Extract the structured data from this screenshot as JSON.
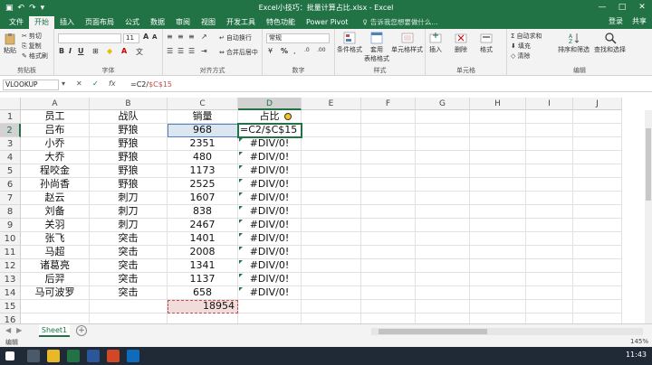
{
  "titlebar": {
    "title": "Excel小技巧：批量计算占比.xlsx - Excel",
    "qat": [
      "save",
      "undo",
      "redo",
      "customize"
    ],
    "window_buttons": [
      "—",
      "□",
      "✕"
    ]
  },
  "tabs": {
    "items": [
      "文件",
      "开始",
      "插入",
      "页面布局",
      "公式",
      "数据",
      "审阅",
      "视图",
      "开发工具",
      "特色功能",
      "Power Pivot"
    ],
    "active": "开始",
    "tell_me": "告诉我您想要做什么...",
    "right": [
      "登录",
      "共享"
    ]
  },
  "ribbon": {
    "clipboard": {
      "paste": "粘贴",
      "cut": "剪切",
      "copy": "复制",
      "format_painter": "格式刷",
      "group_label": "剪贴板"
    },
    "font": {
      "font_size": "11",
      "group_label": "字体"
    },
    "alignment": {
      "wrap": "自动换行",
      "merge": "合并后居中",
      "group_label": "对齐方式"
    },
    "number": {
      "format": "常规",
      "percent": "%",
      "group_label": "数字"
    },
    "styles": {
      "conditional": "条件格式",
      "table": "套用\n表格格式",
      "cell_styles": "单元格样式",
      "group_label": "样式"
    },
    "cells": {
      "insert": "插入",
      "delete": "删除",
      "format": "格式",
      "group_label": "单元格"
    },
    "editing": {
      "autosum": "自动求和",
      "fill": "填充",
      "clear": "清除",
      "sort": "排序和筛选",
      "find": "查找和选择",
      "group_label": "编辑"
    }
  },
  "formula_bar": {
    "name_box": "VLOOKUP",
    "fx": "fx",
    "formula_prefix": "=C2/",
    "formula_ref": "$C$15"
  },
  "columns": [
    "A",
    "B",
    "C",
    "D",
    "E",
    "F",
    "G",
    "H",
    "I",
    "J"
  ],
  "rows": [
    "1",
    "2",
    "3",
    "4",
    "5",
    "6",
    "7",
    "8",
    "9",
    "10",
    "11",
    "12",
    "13",
    "14",
    "15",
    "16"
  ],
  "table": {
    "header": [
      "员工",
      "战队",
      "销量",
      "占比"
    ],
    "data": [
      [
        "吕布",
        "野狼",
        "968",
        "=C2/$C$15"
      ],
      [
        "小乔",
        "野狼",
        "2351",
        "#DIV/0!"
      ],
      [
        "大乔",
        "野狼",
        "480",
        "#DIV/0!"
      ],
      [
        "程咬金",
        "野狼",
        "1173",
        "#DIV/0!"
      ],
      [
        "孙尚香",
        "野狼",
        "2525",
        "#DIV/0!"
      ],
      [
        "赵云",
        "刺刀",
        "1607",
        "#DIV/0!"
      ],
      [
        "刘备",
        "刺刀",
        "838",
        "#DIV/0!"
      ],
      [
        "关羽",
        "刺刀",
        "2467",
        "#DIV/0!"
      ],
      [
        "张飞",
        "突击",
        "1401",
        "#DIV/0!"
      ],
      [
        "马超",
        "突击",
        "2008",
        "#DIV/0!"
      ],
      [
        "诸葛亮",
        "突击",
        "1341",
        "#DIV/0!"
      ],
      [
        "后羿",
        "突击",
        "1137",
        "#DIV/0!"
      ],
      [
        "马可波罗",
        "突击",
        "658",
        "#DIV/0!"
      ]
    ],
    "total": "18954"
  },
  "sheet_tabs": {
    "items": [
      "Sheet1"
    ],
    "add": "+"
  },
  "status": {
    "mode": "编辑",
    "zoom": "145%"
  },
  "taskbar": {
    "time": "11:43"
  }
}
